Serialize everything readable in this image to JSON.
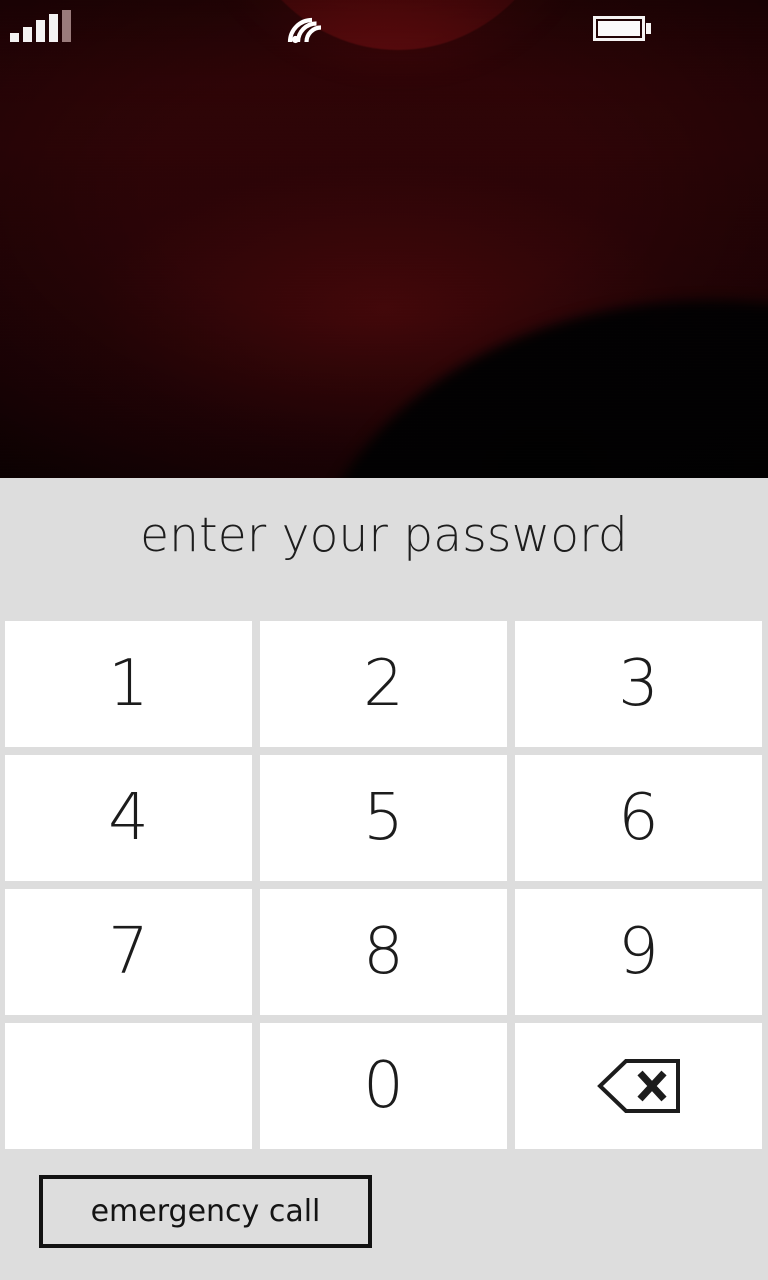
{
  "status_bar": {
    "signal_icon": "signal-bars-icon",
    "signal_bars_filled": 4,
    "signal_bars_total": 5,
    "wifi_icon": "wifi-icon",
    "battery_icon": "battery-full-icon",
    "battery_level_percent": 100
  },
  "wallpaper": {
    "name": "red-sphere-wallpaper",
    "base_color": "#2b0406",
    "accent_color": "#c9171a",
    "shadow_color": "#010101"
  },
  "lock_screen": {
    "prompt": "enter your password",
    "panel_color": "#dddddd",
    "key_color": "#ffffff",
    "text_color": "#1c1c1c",
    "keypad": [
      {
        "label": "1",
        "name": "key-1",
        "type": "digit"
      },
      {
        "label": "2",
        "name": "key-2",
        "type": "digit"
      },
      {
        "label": "3",
        "name": "key-3",
        "type": "digit"
      },
      {
        "label": "4",
        "name": "key-4",
        "type": "digit"
      },
      {
        "label": "5",
        "name": "key-5",
        "type": "digit"
      },
      {
        "label": "6",
        "name": "key-6",
        "type": "digit"
      },
      {
        "label": "7",
        "name": "key-7",
        "type": "digit"
      },
      {
        "label": "8",
        "name": "key-8",
        "type": "digit"
      },
      {
        "label": "9",
        "name": "key-9",
        "type": "digit"
      },
      {
        "label": "",
        "name": "key-blank",
        "type": "blank"
      },
      {
        "label": "0",
        "name": "key-0",
        "type": "digit"
      },
      {
        "label": "",
        "name": "key-backspace",
        "type": "backspace",
        "icon": "backspace-icon"
      }
    ],
    "emergency_call_label": "emergency call"
  }
}
